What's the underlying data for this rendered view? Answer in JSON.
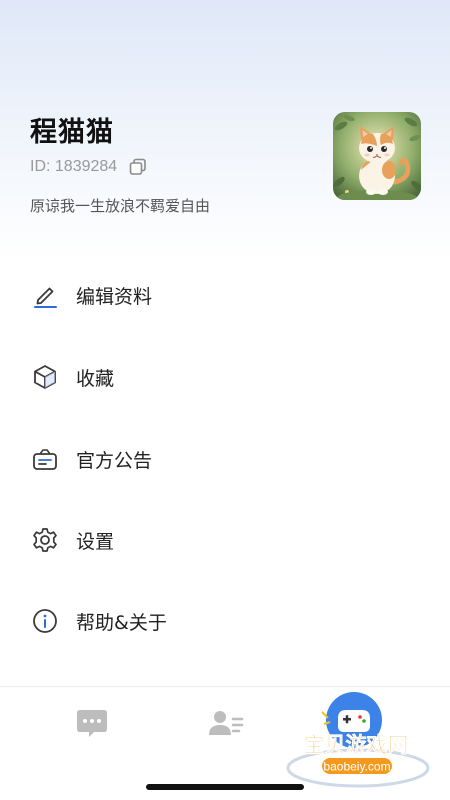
{
  "profile": {
    "username": "程猫猫",
    "id_text": "ID: 1839284",
    "bio": "原谅我一生放浪不羁爱自由"
  },
  "menu": {
    "items": [
      {
        "label": "编辑资料",
        "icon": "edit-icon"
      },
      {
        "label": "收藏",
        "icon": "box-icon"
      },
      {
        "label": "官方公告",
        "icon": "announcement-icon"
      },
      {
        "label": "设置",
        "icon": "gear-icon"
      },
      {
        "label": "帮助&关于",
        "icon": "info-icon"
      }
    ]
  },
  "tabbar": {
    "tabs": [
      {
        "icon": "chat-icon",
        "active": false
      },
      {
        "icon": "profile-icon",
        "active": true
      }
    ]
  },
  "watermark": {
    "title": "宝贝游戏网",
    "url": "baobeiy.com"
  },
  "colors": {
    "icon": "#3a3a3a",
    "accent_underline": "#2f6bd8",
    "tab_icon": "#bdbdbd",
    "watermark_orange": "#f39a1e"
  }
}
